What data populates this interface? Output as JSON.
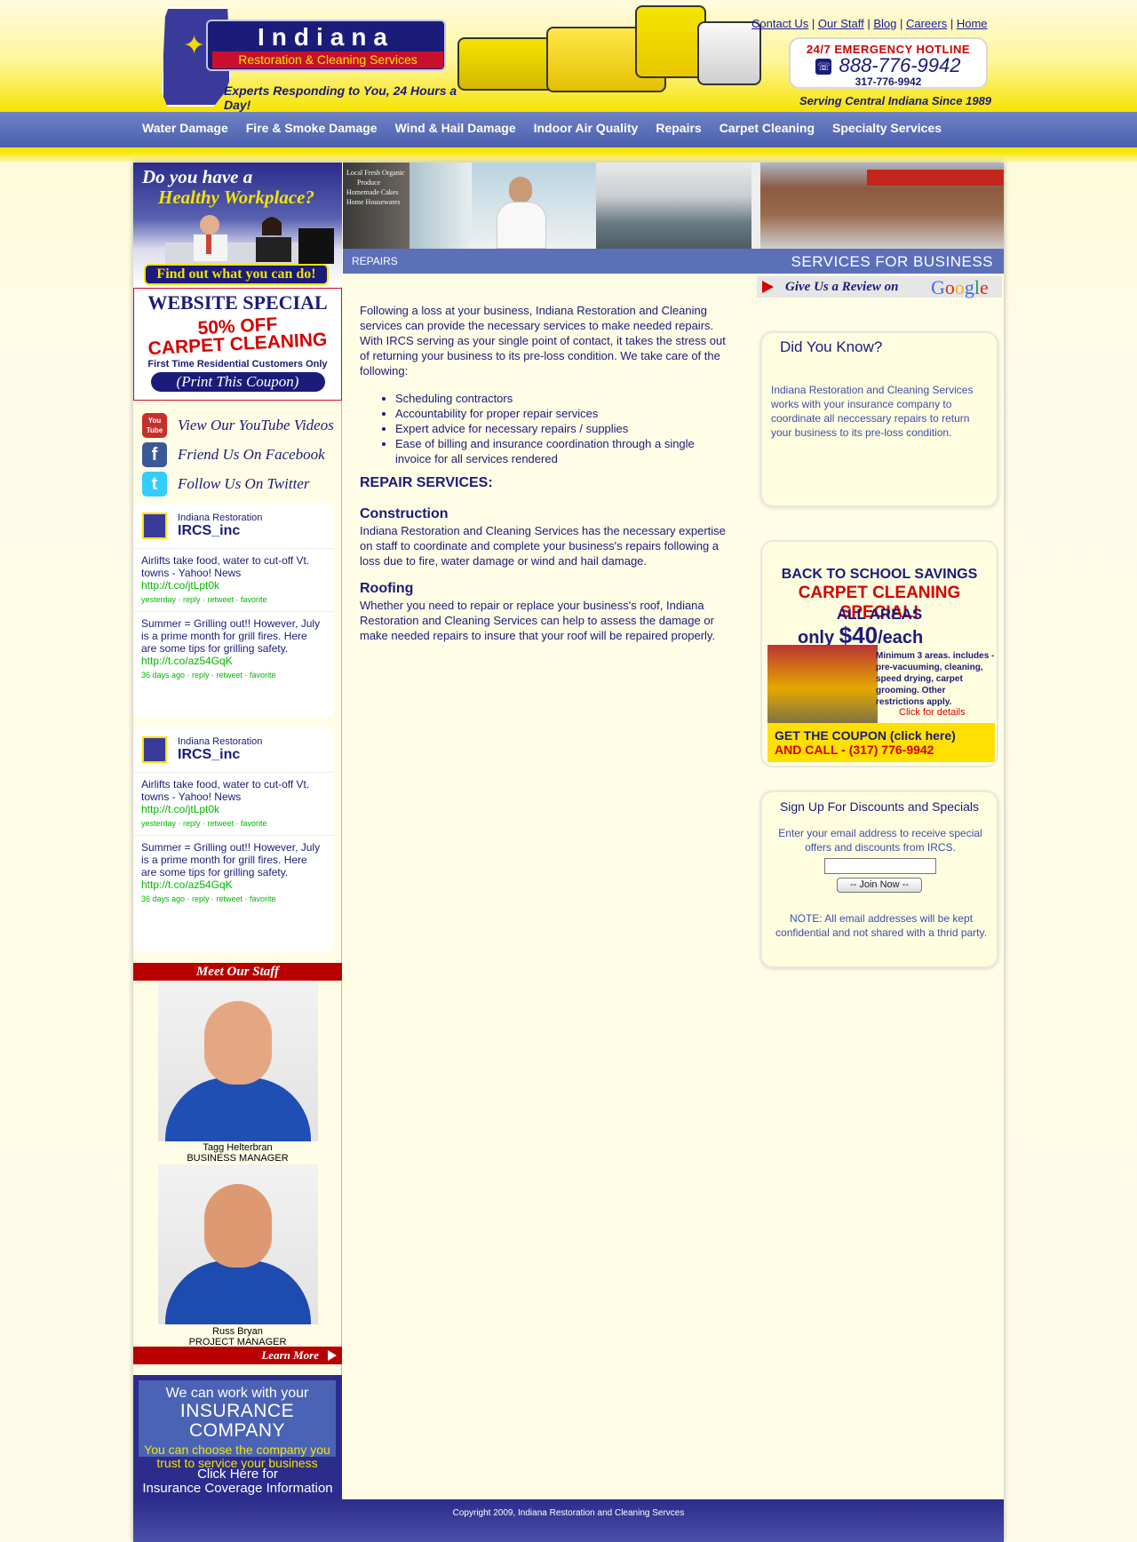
{
  "header": {
    "logo_title": "Indiana",
    "logo_sub": "Restoration & Cleaning Services",
    "tagline": "Experts Responding to You,  24 Hours a Day!",
    "top_links": [
      "Contact Us",
      "Our Staff",
      "Blog",
      "Careers",
      "Home"
    ],
    "hotline_title": "24/7 EMERGENCY HOTLINE",
    "hotline_phone": "888-776-9942",
    "hotline_phone2": "317-776-9942",
    "serving": "Serving Central Indiana Since 1989"
  },
  "nav": {
    "items": [
      "Water Damage",
      "Fire & Smoke Damage",
      "Wind & Hail Damage",
      "Indoor Air Quality",
      "Repairs",
      "Carpet Cleaning",
      "Specialty Services"
    ]
  },
  "left": {
    "healthy_q1": "Do you have a",
    "healthy_q2": "Healthy Workplace?",
    "find_out": "Find out what you can do!",
    "coupon_heading": "WEBSITE SPECIAL",
    "coupon_50": "50% OFF",
    "coupon_cc": "CARPET CLEANING",
    "coupon_first": "First Time Residential Customers Only",
    "coupon_print": "(Print This Coupon)",
    "social": [
      {
        "label": "View Our YouTube Videos",
        "icon": "youtube-icon",
        "icon_text": "You Tube",
        "color": "#c4302b"
      },
      {
        "label": "Friend Us On Facebook",
        "icon": "facebook-icon",
        "icon_text": "f",
        "color": "#3b5998"
      },
      {
        "label": "Follow Us On Twitter",
        "icon": "twitter-icon",
        "icon_text": "t",
        "color": "#33ccff"
      }
    ],
    "twitter": {
      "name": "Indiana Restoration",
      "handle": "IRCS_inc",
      "tweets": [
        {
          "text": "Airlifts take food, water to cut-off Vt. towns - Yahoo! News",
          "link": "http://t.co/jtLpt0k",
          "meta": "yesterday · reply · retweet · favorite"
        },
        {
          "text": "Summer = Grilling out!! However, July is a prime month for grill fires. Here are some tips for grilling safety.",
          "link": "http://t.co/az54GqK",
          "meta": "36 days ago · reply · retweet · favorite"
        }
      ]
    },
    "staff_heading": "Meet Our Staff",
    "staff": [
      {
        "name": "Tagg Helterbran",
        "title": "BUSINESS MANAGER"
      },
      {
        "name": "Russ Bryan",
        "title": "PROJECT MANAGER"
      }
    ],
    "learn_more": "Learn More",
    "insurance_l1": "We can work with your",
    "insurance_l2": "INSURANCE COMPANY",
    "insurance_l3": "You can choose the company you trust to service your business",
    "insurance_click1": "Click Here for",
    "insurance_click2": "Insurance Coverage Information"
  },
  "main": {
    "page_name": "REPAIRS",
    "services_biz": "SERVICES FOR BUSINESS",
    "intro": "Following a loss at your business, Indiana Restoration and Cleaning services can provide the necessary services to make needed repairs. With IRCS serving as your single point of contact, it takes the stress out of returning your business to its pre-loss condition. We take care of the following:",
    "bullets": [
      "Scheduling contractors",
      "Accountability for proper repair services",
      "Expert advice for necessary repairs / supplies",
      "Ease of billing and insurance coordination through a single invoice for all services rendered"
    ],
    "repair_heading": "REPAIR SERVICES:",
    "construction_h": "Construction",
    "construction_t": "Indiana Restoration and Cleaning Services has the necessary expertise on staff to coordinate and complete your business's repairs following a loss due to fire, water damage or wind and hail damage.",
    "roofing_h": "Roofing",
    "roofing_t": "Whether you need to repair or replace your business's roof, Indiana Restoration and Cleaning Services can help to assess the damage or make needed repairs to insure that your roof will be repaired properly.",
    "banner_text": [
      "Local Fresh Organic",
      "Produce",
      "Homemade Cakes",
      "Home Housewares"
    ]
  },
  "right": {
    "review_text": "Give Us a Review on",
    "google": "Google",
    "know_h": "Did You Know?",
    "know_t": "Indiana Restoration and Cleaning Services works with your insurance company to coordinate all neccessary repairs to return your business to its pre-loss condition.",
    "school_1": "BACK TO SCHOOL SAVINGS",
    "school_2": "CARPET CLEANING SPECIAL!",
    "school_3": "ALL AREAS",
    "school_4a": "only ",
    "school_4b": "$40",
    "school_4c": "/each",
    "school_5": "Minimum 3 areas. includes - pre-vacuuming, cleaning, speed drying, carpet grooming. Other restrictions apply.",
    "school_6": "Click for details",
    "school_coupon1": "GET THE COUPON (click here)",
    "school_coupon2": "AND CALL - (317) 776-9942",
    "signup_h": "Sign Up For Discounts and Specials",
    "signup_t": "Enter your email address to receive special offers and discounts from IRCS.",
    "signup_btn": "-- Join Now --",
    "signup_note": "NOTE: All email addresses will be kept confidential and not shared with a thrid party."
  },
  "footer": {
    "copyright": "Copyright 2009, Indiana Restoration and Cleaning Servces"
  }
}
